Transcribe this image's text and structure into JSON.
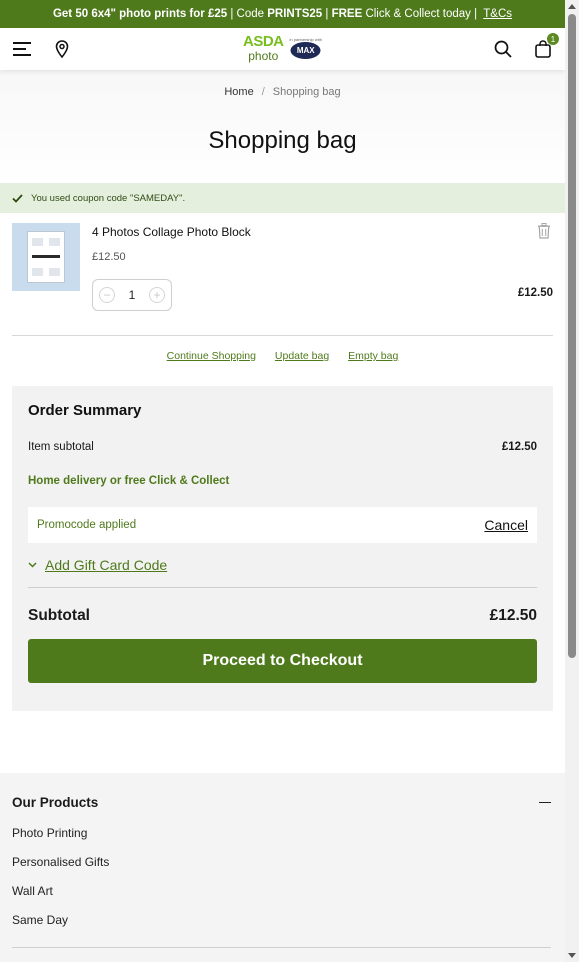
{
  "promo_bar": {
    "part1": "Get 50 6x4\" photo prints for £25",
    "part2": " | Code ",
    "code": "PRINTS25",
    "part3": " | ",
    "free": "FREE",
    "part4": " Click & Collect today | ",
    "tcs": "T&Cs"
  },
  "header": {
    "logo_asda": "ASDA",
    "logo_photo": "photo",
    "logo_partner_small": "in partnership with",
    "logo_partner": "MAX",
    "bag_count": "1",
    "icons": [
      "menu-icon",
      "location-pin-icon",
      "search-icon",
      "bag-icon"
    ]
  },
  "breadcrumb": {
    "home": "Home",
    "separator": "/",
    "current": "Shopping bag"
  },
  "page_title": "Shopping bag",
  "coupon_note": "You used coupon code \"SAMEDAY\".",
  "cart_item": {
    "name": "4 Photos Collage Photo Block",
    "unit_price": "£12.50",
    "quantity": "1",
    "line_total": "£12.50"
  },
  "bag_actions": {
    "continue": "Continue Shopping",
    "update": "Update bag",
    "empty": "Empty bag"
  },
  "order_summary": {
    "title": "Order Summary",
    "item_subtotal_label": "Item subtotal",
    "item_subtotal_value": "£12.50",
    "delivery_note": "Home delivery or free Click & Collect",
    "promo_applied": "Promocode applied",
    "cancel": "Cancel",
    "gift_card": "Add Gift Card Code",
    "subtotal_label": "Subtotal",
    "subtotal_value": "£12.50",
    "checkout": "Proceed to Checkout"
  },
  "footer": {
    "heading": "Our Products",
    "links": [
      "Photo Printing",
      "Personalised Gifts",
      "Wall Art",
      "Same Day"
    ]
  },
  "colors": {
    "brand_green": "#4f7a1c",
    "asda_green": "#78be20",
    "coupon_bg": "#e4efdd",
    "summary_bg": "#f2f2f2"
  }
}
